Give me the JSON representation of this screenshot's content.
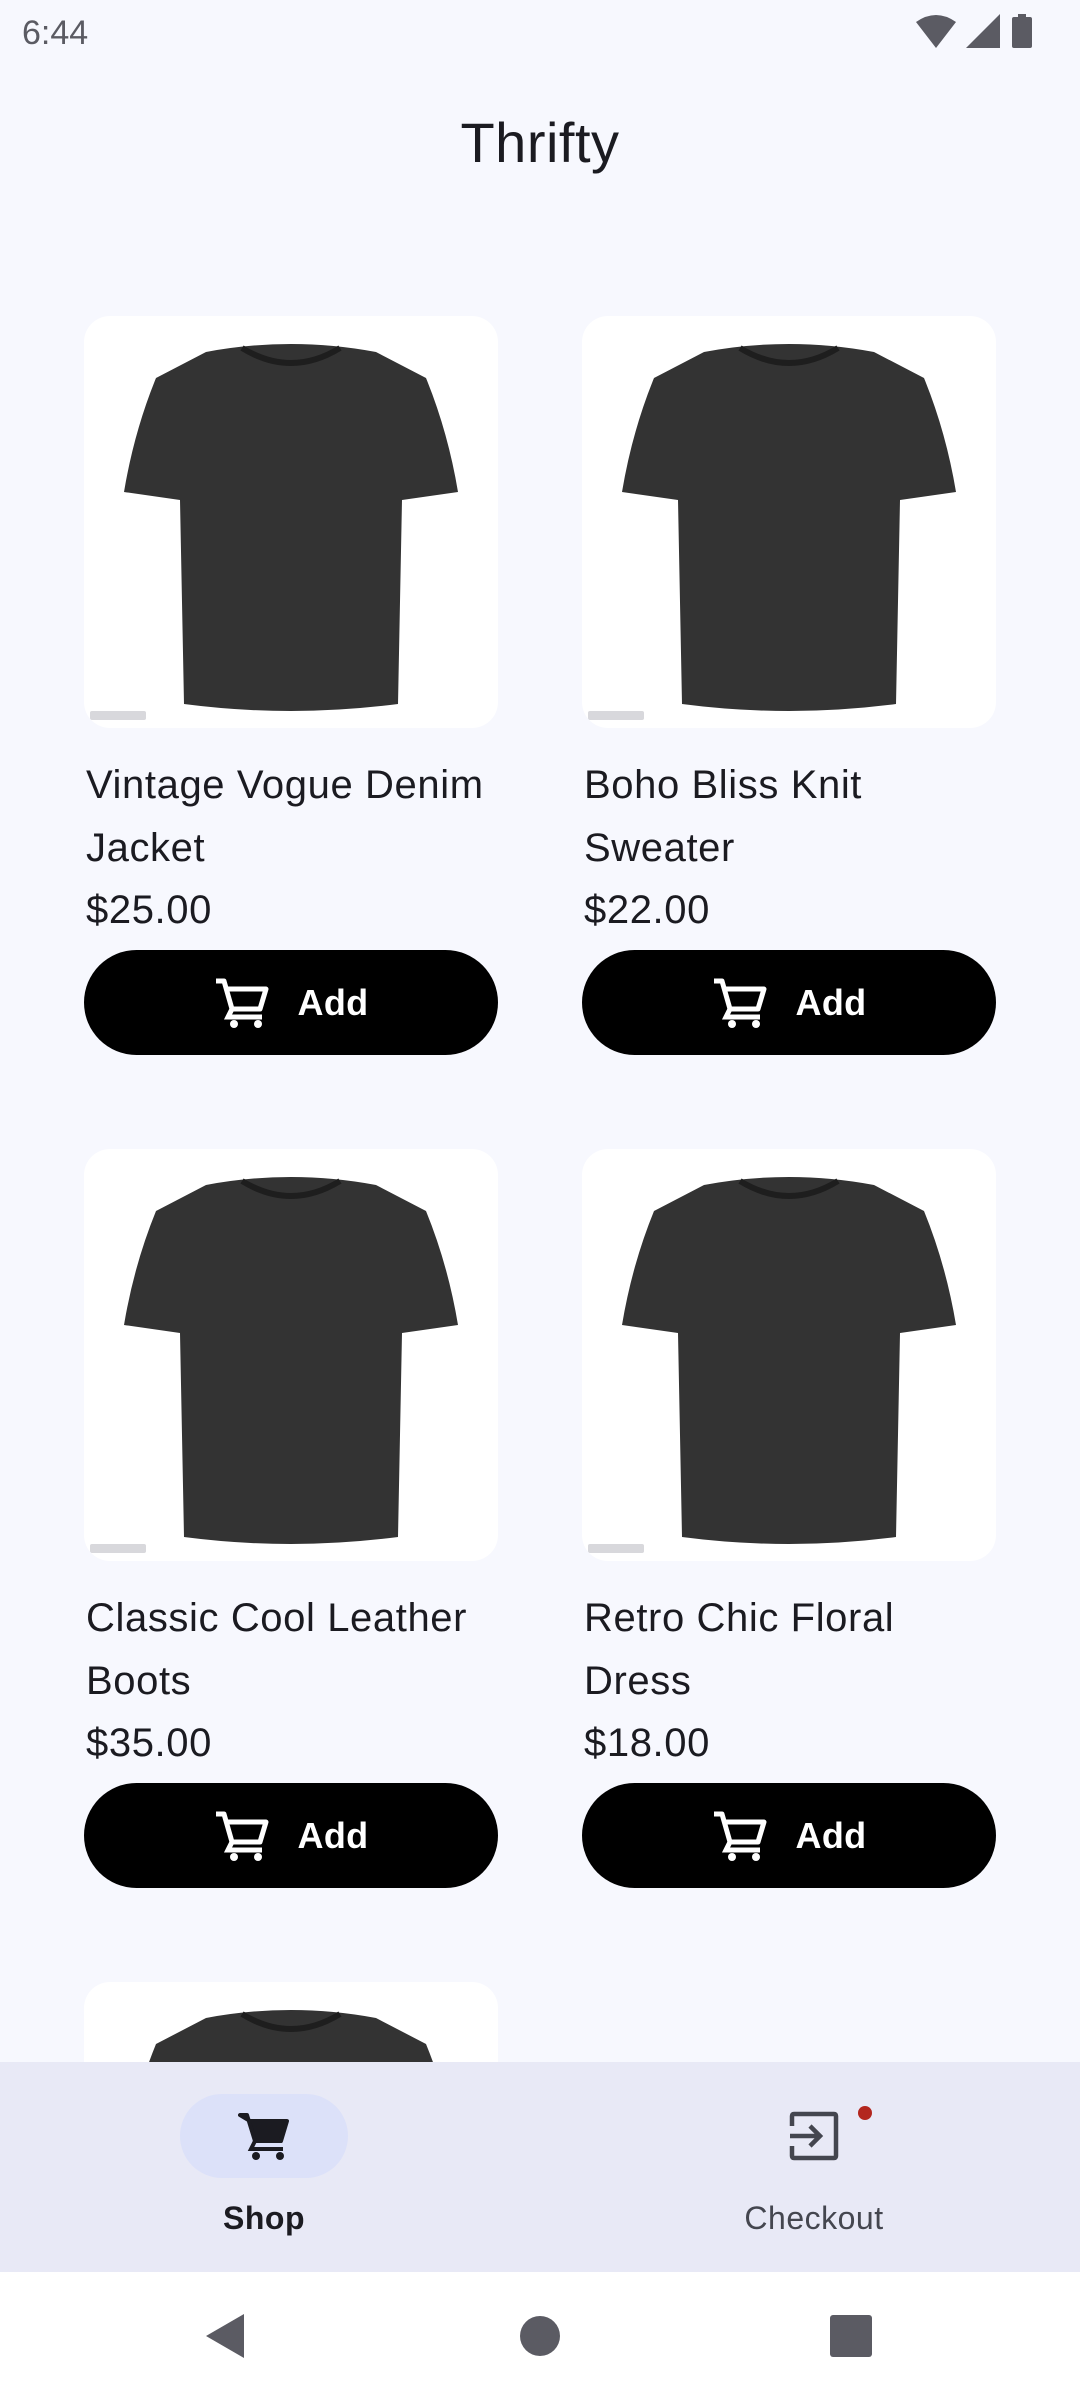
{
  "status_bar": {
    "time": "6:44",
    "icons": [
      "wifi-icon",
      "cellular-signal-icon",
      "battery-icon"
    ]
  },
  "app": {
    "title": "Thrifty"
  },
  "products": [
    {
      "name": "Vintage Vogue Denim Jacket",
      "price": "$25.00",
      "button_label": "Add",
      "image": "black-tshirt"
    },
    {
      "name": "Boho Bliss Knit Sweater",
      "price": "$22.00",
      "button_label": "Add",
      "image": "black-tshirt"
    },
    {
      "name": "Classic Cool Leather Boots",
      "price": "$35.00",
      "button_label": "Add",
      "image": "black-tshirt"
    },
    {
      "name": "Retro Chic Floral Dress",
      "price": "$18.00",
      "button_label": "Add",
      "image": "black-tshirt"
    },
    {
      "name": "",
      "price": "",
      "button_label": "",
      "image": "black-tshirt"
    }
  ],
  "bottom_nav": {
    "items": [
      {
        "label": "Shop",
        "icon": "shopping-cart-icon",
        "active": true
      },
      {
        "label": "Checkout",
        "icon": "checkout-exit-icon",
        "active": false,
        "badge": true
      }
    ]
  },
  "system_nav": {
    "buttons": [
      "back-icon",
      "home-icon",
      "recents-icon"
    ]
  },
  "colors": {
    "background": "#f7f8fe",
    "button": "#000000",
    "nav_background": "#e8e9f6",
    "nav_active_pill": "#dce1f9",
    "badge": "#b3261e"
  }
}
